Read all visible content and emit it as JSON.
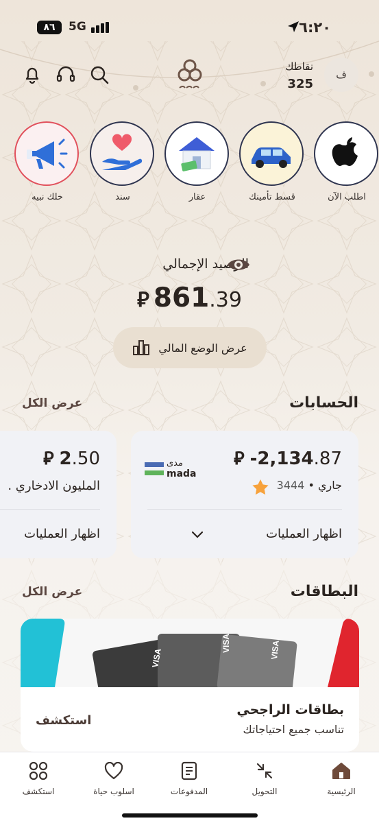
{
  "status_bar": {
    "time": "٦:٢٠",
    "network": "5G",
    "battery": "٨٦"
  },
  "header": {
    "avatar_initial": "ف",
    "points_label": "نقاطك",
    "points_value": "325",
    "icons": [
      "notification-icon",
      "support-icon",
      "search-icon"
    ]
  },
  "stories": [
    {
      "label": "اطلب الآن",
      "icon": "apple-icon"
    },
    {
      "label": "قسط تأمينك",
      "icon": "car-icon"
    },
    {
      "label": "عقار",
      "icon": "house-icon"
    },
    {
      "label": "سند",
      "icon": "heart-hand-icon"
    },
    {
      "label": "خلك نبيه",
      "icon": "megaphone-icon"
    }
  ],
  "balance": {
    "label": "الرصيد الإجمالي",
    "amount_int": "861",
    "amount_dec": ".39",
    "currency": "⃁",
    "button_label": "عرض الوضع المالي"
  },
  "accounts": {
    "title": "الحسابات",
    "view_all": "عرض الكل",
    "items": [
      {
        "amount_int": "-2,134",
        "amount_dec": ".87",
        "currency": "⃁",
        "type": "جاري",
        "number": "3444",
        "brand_ar": "مدى",
        "brand_en": "mada",
        "action": "اظهار العمليات"
      },
      {
        "amount_int": "2",
        "amount_dec": ".50",
        "currency": "⃁",
        "name": "المليون الادخاري .",
        "action": "اظهار العمليات"
      }
    ]
  },
  "cards": {
    "title": "البطاقات",
    "view_all": "عرض الكل",
    "promo_title": "بطاقات الراجحي",
    "promo_subtitle": "تناسب جميع احتياجاتك",
    "promo_button": "استكشف"
  },
  "bottom_nav": [
    {
      "label": "الرئيسية",
      "icon": "home-icon",
      "active": true
    },
    {
      "label": "التحويل",
      "icon": "transfer-icon"
    },
    {
      "label": "المدفوعات",
      "icon": "payments-icon"
    },
    {
      "label": "اسلوب حياة",
      "icon": "heart-icon"
    },
    {
      "label": "استكشف",
      "icon": "explore-icon"
    }
  ],
  "colors": {
    "accent_brown": "#5a4640",
    "star_orange": "#f7a23c",
    "mada_blue": "#4a6bb3",
    "mada_green": "#5fb35a"
  }
}
